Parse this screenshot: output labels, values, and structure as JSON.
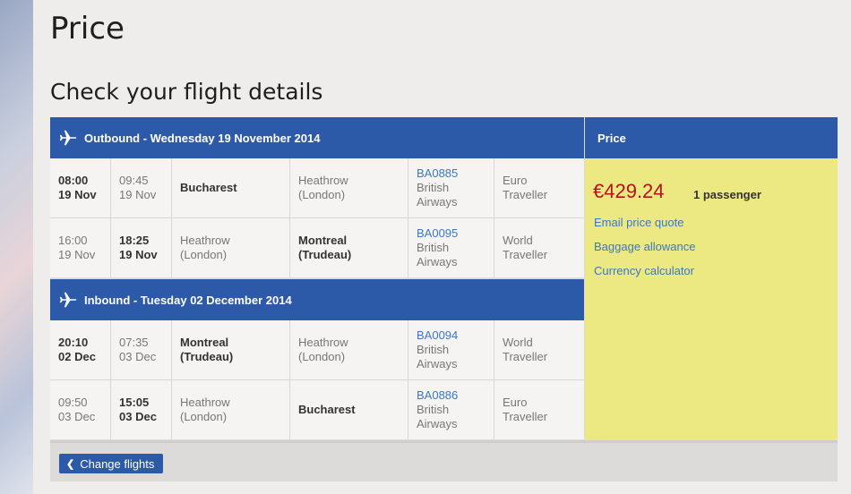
{
  "page": {
    "title": "Price",
    "subtitle": "Check your flight details"
  },
  "outbound": {
    "header": "Outbound - Wednesday 19 November 2014",
    "flights": [
      {
        "dep_time": "08:00",
        "dep_date": "19 Nov",
        "arr_time": "09:45",
        "arr_date": "19 Nov",
        "from_line1": "Bucharest",
        "from_line2": "",
        "to_line1": "Heathrow",
        "to_line2": "(London)",
        "flight_no": "BA0885",
        "airline_line1": "British",
        "airline_line2": "Airways",
        "cabin_line1": "Euro",
        "cabin_line2": "Traveller"
      },
      {
        "dep_time": "16:00",
        "dep_date": "19 Nov",
        "arr_time": "18:25",
        "arr_date": "19 Nov",
        "from_line1": "Heathrow",
        "from_line2": "(London)",
        "to_line1": "Montreal",
        "to_line2": "(Trudeau)",
        "flight_no": "BA0095",
        "airline_line1": "British",
        "airline_line2": "Airways",
        "cabin_line1": "World",
        "cabin_line2": "Traveller"
      }
    ]
  },
  "inbound": {
    "header": "Inbound - Tuesday 02 December 2014",
    "flights": [
      {
        "dep_time": "20:10",
        "dep_date": "02 Dec",
        "arr_time": "07:35",
        "arr_date": "03 Dec",
        "from_line1": "Montreal",
        "from_line2": "(Trudeau)",
        "to_line1": "Heathrow",
        "to_line2": "(London)",
        "flight_no": "BA0094",
        "airline_line1": "British",
        "airline_line2": "Airways",
        "cabin_line1": "World",
        "cabin_line2": "Traveller"
      },
      {
        "dep_time": "09:50",
        "dep_date": "03 Dec",
        "arr_time": "15:05",
        "arr_date": "03 Dec",
        "from_line1": "Heathrow",
        "from_line2": "(London)",
        "to_line1": "Bucharest",
        "to_line2": "",
        "flight_no": "BA0886",
        "airline_line1": "British",
        "airline_line2": "Airways",
        "cabin_line1": "Euro",
        "cabin_line2": "Traveller"
      }
    ]
  },
  "price": {
    "header": "Price",
    "amount": "€429.24",
    "passengers": "1 passenger",
    "links": [
      "Email price quote",
      "Baggage allowance",
      "Currency calculator"
    ]
  },
  "footer": {
    "change_flights": "Change flights"
  },
  "colors": {
    "band": "#2d5aa8",
    "price_panel": "#ece882",
    "price_amount": "#b3121f",
    "link": "#3c78c3"
  },
  "icons": {
    "band_icon": "airplane-icon",
    "button_icon": "chevron-left-icon"
  }
}
